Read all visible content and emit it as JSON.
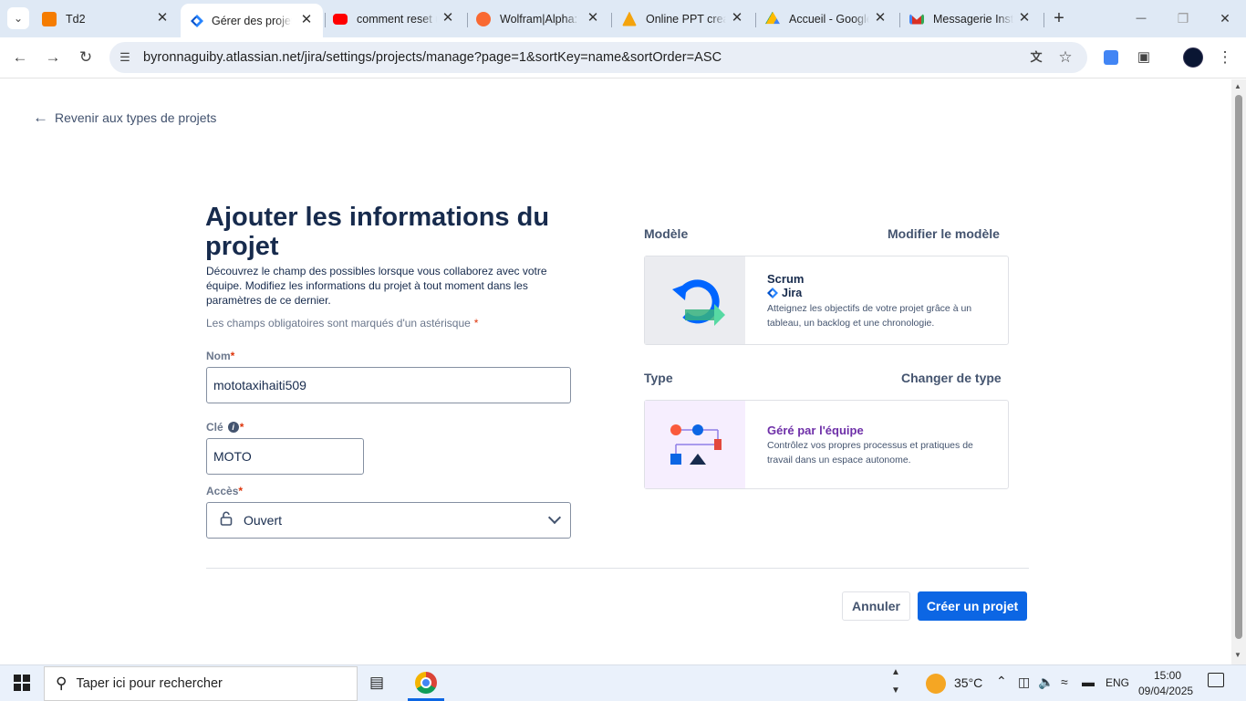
{
  "browser": {
    "tabs": [
      {
        "title": "Td2",
        "icon": "blogger-icon",
        "color": "#f57c00"
      },
      {
        "title": "Gérer des projets",
        "icon": "jira-icon",
        "color": "#2684ff",
        "active": true
      },
      {
        "title": "comment reset un",
        "icon": "youtube-icon",
        "color": "#ff0000"
      },
      {
        "title": "Wolfram|Alpha: C",
        "icon": "wolfram-icon",
        "color": "#f96932"
      },
      {
        "title": "Online PPT creat",
        "icon": "ppt-icon",
        "color": "#f4a30c"
      },
      {
        "title": "Accueil - Google",
        "icon": "google-drive-icon",
        "color": "#1ea362"
      },
      {
        "title": "Messagerie Instit",
        "icon": "gmail-icon",
        "color": "#d93025"
      }
    ],
    "url": "byronnaguiby.atlassian.net/jira/settings/projects/manage?page=1&sortKey=name&sortOrder=ASC",
    "new_tab": "+",
    "minimize": "—",
    "restore": "❐",
    "close": "✕"
  },
  "page": {
    "back_link": "Revenir aux types de projets",
    "title": "Ajouter les informations du projet",
    "description": "Découvrez le champ des possibles lorsque vous collaborez avec votre équipe. Modifiez les informations du projet à tout moment dans les paramètres de ce dernier.",
    "required_note": "Les champs obligatoires sont marqués d'un astérisque",
    "asterisk": "*",
    "name_label": "Nom",
    "name_value": "mototaxihaiti509",
    "key_label": "Clé",
    "key_value": "MOTO",
    "access_label": "Accès",
    "access_value": "Ouvert",
    "template_heading": "Modèle",
    "template_link": "Modifier le modèle",
    "template_card": {
      "title": "Scrum",
      "product": "Jira",
      "description": "Atteignez les objectifs de votre projet grâce à un tableau, un backlog et une chronologie."
    },
    "type_heading": "Type",
    "type_link": "Changer de type",
    "type_card": {
      "title": "Géré par l'équipe",
      "description": "Contrôlez vos propres processus et pratiques de travail dans un espace autonome."
    },
    "cancel_label": "Annuler",
    "create_label": "Créer un projet",
    "accent": "#0c66e4",
    "type_color": "#6e2fa8"
  },
  "taskbar": {
    "search_placeholder": "Taper ici pour rechercher",
    "temperature": "35°C",
    "language": "ENG",
    "time": "15:00",
    "date": "09/04/2025"
  }
}
